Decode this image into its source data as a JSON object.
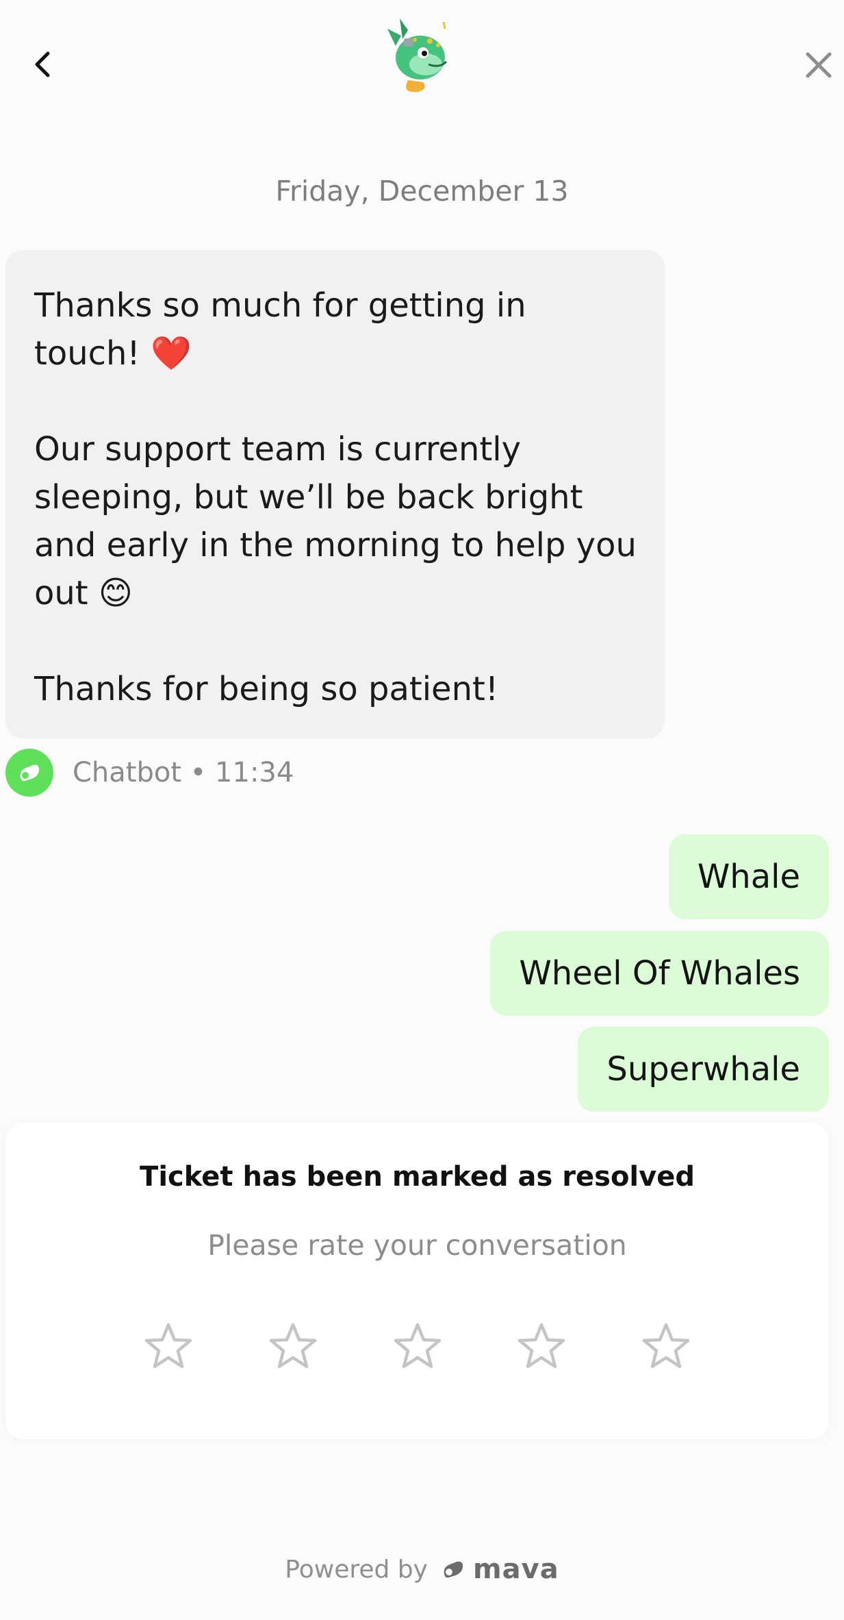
{
  "header": {
    "back_icon": "chevron-left-icon",
    "close_icon": "close-icon",
    "logo": "whale-mascot-logo"
  },
  "conversation": {
    "date": "Friday, December 13",
    "bot_message": {
      "para1": "Thanks so much for getting in touch!",
      "para1_emoji": "❤️",
      "para2": "Our support team is currently sleeping, but we’ll be back bright and early in the morning to help you out",
      "para2_emoji": "😊",
      "para3": "Thanks for being so patient!"
    },
    "meta": "Chatbot • 11:34",
    "user_messages": [
      "Whale",
      "Wheel Of Whales",
      "Superwhale"
    ]
  },
  "resolved": {
    "title": "Ticket has been marked as resolved",
    "subtitle": "Please rate your conversation",
    "stars_count": 5,
    "rating": 0
  },
  "footer": {
    "powered_by": "Powered by",
    "brand": "mava"
  },
  "colors": {
    "background": "#fbfbfb",
    "bot_bubble": "#f1f1f1",
    "user_bubble": "#dcfbd7",
    "avatar_green": "#5ee05b",
    "star_outline": "#c4c4c4"
  }
}
